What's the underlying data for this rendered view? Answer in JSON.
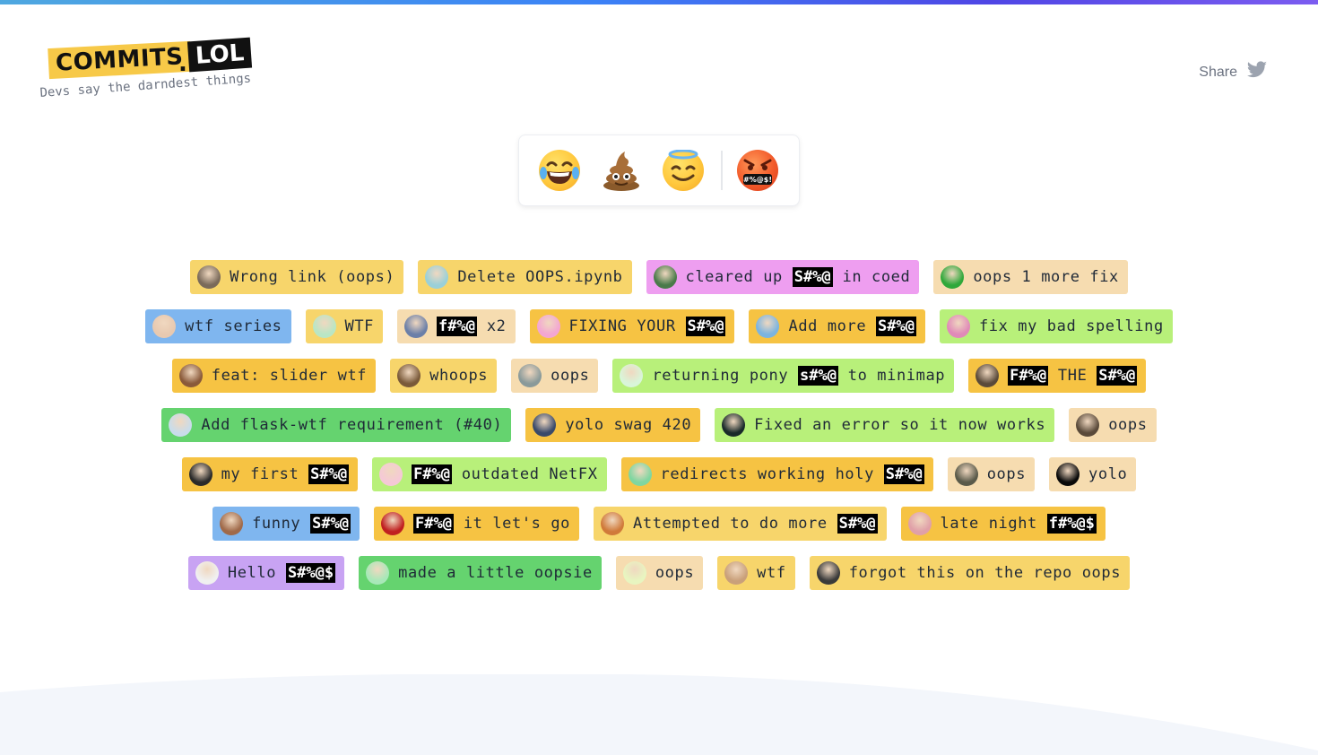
{
  "logo": {
    "word1": "COMMITS",
    "dot": ".",
    "word2": "LOL",
    "tagline": "Devs say the darndest things"
  },
  "share": {
    "label": "Share",
    "icon": "twitter-icon"
  },
  "emoji_bar": {
    "items": [
      {
        "name": "joy-emoji",
        "label": "😂"
      },
      {
        "name": "poop-emoji",
        "label": "💩"
      },
      {
        "name": "innocent-emoji",
        "label": "😇"
      },
      {
        "name": "cursing-emoji",
        "label": "🤬"
      }
    ],
    "cursing_text": "#%@$!"
  },
  "colors": {
    "yellow": "#f7d56b",
    "orange": "#f6c343",
    "pink": "#ee9ef0",
    "peach": "#f6dcb0",
    "blue": "#7fb6ef",
    "lime": "#b8f07a",
    "green": "#65d36f",
    "purple": "#c8a3f3"
  },
  "rows": [
    [
      {
        "text": "Wrong link (oops)",
        "censored": "",
        "after": "",
        "color": "#f7d56b",
        "avatar": "#7a6a5a"
      },
      {
        "text": "Delete OOPS.ipynb",
        "censored": "",
        "after": "",
        "color": "#f7d56b",
        "avatar": "#9ad0d8"
      },
      {
        "text": "cleared up ",
        "censored": "S#%@",
        "after": " in coed",
        "color": "#ee9ef0",
        "avatar": "#4a7a4a"
      },
      {
        "text": "oops 1 more fix",
        "censored": "",
        "after": "",
        "color": "#f6dcb0",
        "avatar": "#2fa83a"
      }
    ],
    [
      {
        "text": "wtf series",
        "censored": "",
        "after": "",
        "color": "#7fb6ef",
        "avatar": "#e8c9b0"
      },
      {
        "text": "WTF",
        "censored": "",
        "after": "",
        "color": "#f7d56b",
        "avatar": "#b9e6c4"
      },
      {
        "text": "",
        "censored": "f#%@",
        "after": " x2",
        "color": "#f6dcb0",
        "avatar": "#6b7fa8"
      },
      {
        "text": "FIXING YOUR ",
        "censored": "S#%@",
        "after": "",
        "color": "#f6c343",
        "avatar": "#f3a6d2"
      },
      {
        "text": "Add more ",
        "censored": "S#%@",
        "after": "",
        "color": "#f6c343",
        "avatar": "#7bb4e0"
      },
      {
        "text": "fix my bad spelling",
        "censored": "",
        "after": "",
        "color": "#b8f07a",
        "avatar": "#e08ab8"
      }
    ],
    [
      {
        "text": "feat: slider wtf",
        "censored": "",
        "after": "",
        "color": "#f6c343",
        "avatar": "#8a5a3a"
      },
      {
        "text": "whoops",
        "censored": "",
        "after": "",
        "color": "#f7d56b",
        "avatar": "#7a5a3a"
      },
      {
        "text": "oops",
        "censored": "",
        "after": "",
        "color": "#f6dcb0",
        "avatar": "#8a9a9a"
      },
      {
        "text": "returning pony ",
        "censored": "s#%@",
        "after": " to minimap",
        "color": "#b8f07a",
        "avatar": "#d9f5d9"
      },
      {
        "text": "",
        "censored": "F#%@",
        "after": " THE ",
        "censored2": "S#%@",
        "color": "#f6c343",
        "avatar": "#5a4a3a"
      }
    ],
    [
      {
        "text": "Add flask-wtf requirement (#40)",
        "censored": "",
        "after": "",
        "color": "#65d36f",
        "avatar": "#c9dcea"
      },
      {
        "text": "yolo swag 420",
        "censored": "",
        "after": "",
        "color": "#f6c343",
        "avatar": "#3a4a6a"
      },
      {
        "text": "Fixed an error so it now works",
        "censored": "",
        "after": "",
        "color": "#b8f07a",
        "avatar": "#1a2a2a"
      },
      {
        "text": "oops",
        "censored": "",
        "after": "",
        "color": "#f6dcb0",
        "avatar": "#5a4a3a"
      }
    ],
    [
      {
        "text": "my first ",
        "censored": "S#%@",
        "after": "",
        "color": "#f6c343",
        "avatar": "#2a2a2a"
      },
      {
        "text": "",
        "censored": "F#%@",
        "after": " outdated NetFX",
        "color": "#b8f07a",
        "avatar": "#f5c9d6"
      },
      {
        "text": "redirects working holy ",
        "censored": "S#%@",
        "after": "",
        "color": "#f6c343",
        "avatar": "#7fd6a0"
      },
      {
        "text": "oops",
        "censored": "",
        "after": "",
        "color": "#f6dcb0",
        "avatar": "#5a5a4a"
      },
      {
        "text": "yolo",
        "censored": "",
        "after": "",
        "color": "#f6dcb0",
        "avatar": "#0a0a0a"
      }
    ],
    [
      {
        "text": "funny ",
        "censored": "S#%@",
        "after": "",
        "color": "#7fb6ef",
        "avatar": "#a06a4a"
      },
      {
        "text": "",
        "censored": "F#%@",
        "after": " it let's go",
        "color": "#f6c343",
        "avatar": "#c02020"
      },
      {
        "text": "Attempted to do more ",
        "censored": "S#%@",
        "after": "",
        "color": "#f7d56b",
        "avatar": "#d07a3a"
      },
      {
        "text": "late night ",
        "censored": "f#%@$",
        "after": "",
        "color": "#f6c343",
        "avatar": "#e0a0a8"
      }
    ],
    [
      {
        "text": "Hello ",
        "censored": "S#%@$",
        "after": "",
        "color": "#c8a3f3",
        "avatar": "#f0f0f0"
      },
      {
        "text": "made a little oopsie",
        "censored": "",
        "after": "",
        "color": "#65d36f",
        "avatar": "#a8e8b8"
      },
      {
        "text": "oops",
        "censored": "",
        "after": "",
        "color": "#f6dcb0",
        "avatar": "#e8f5c0"
      },
      {
        "text": "wtf",
        "censored": "",
        "after": "",
        "color": "#f7d56b",
        "avatar": "#c9a07a"
      },
      {
        "text": "forgot this on the repo oops",
        "censored": "",
        "after": "",
        "color": "#f7d56b",
        "avatar": "#3a3a3a"
      }
    ]
  ]
}
